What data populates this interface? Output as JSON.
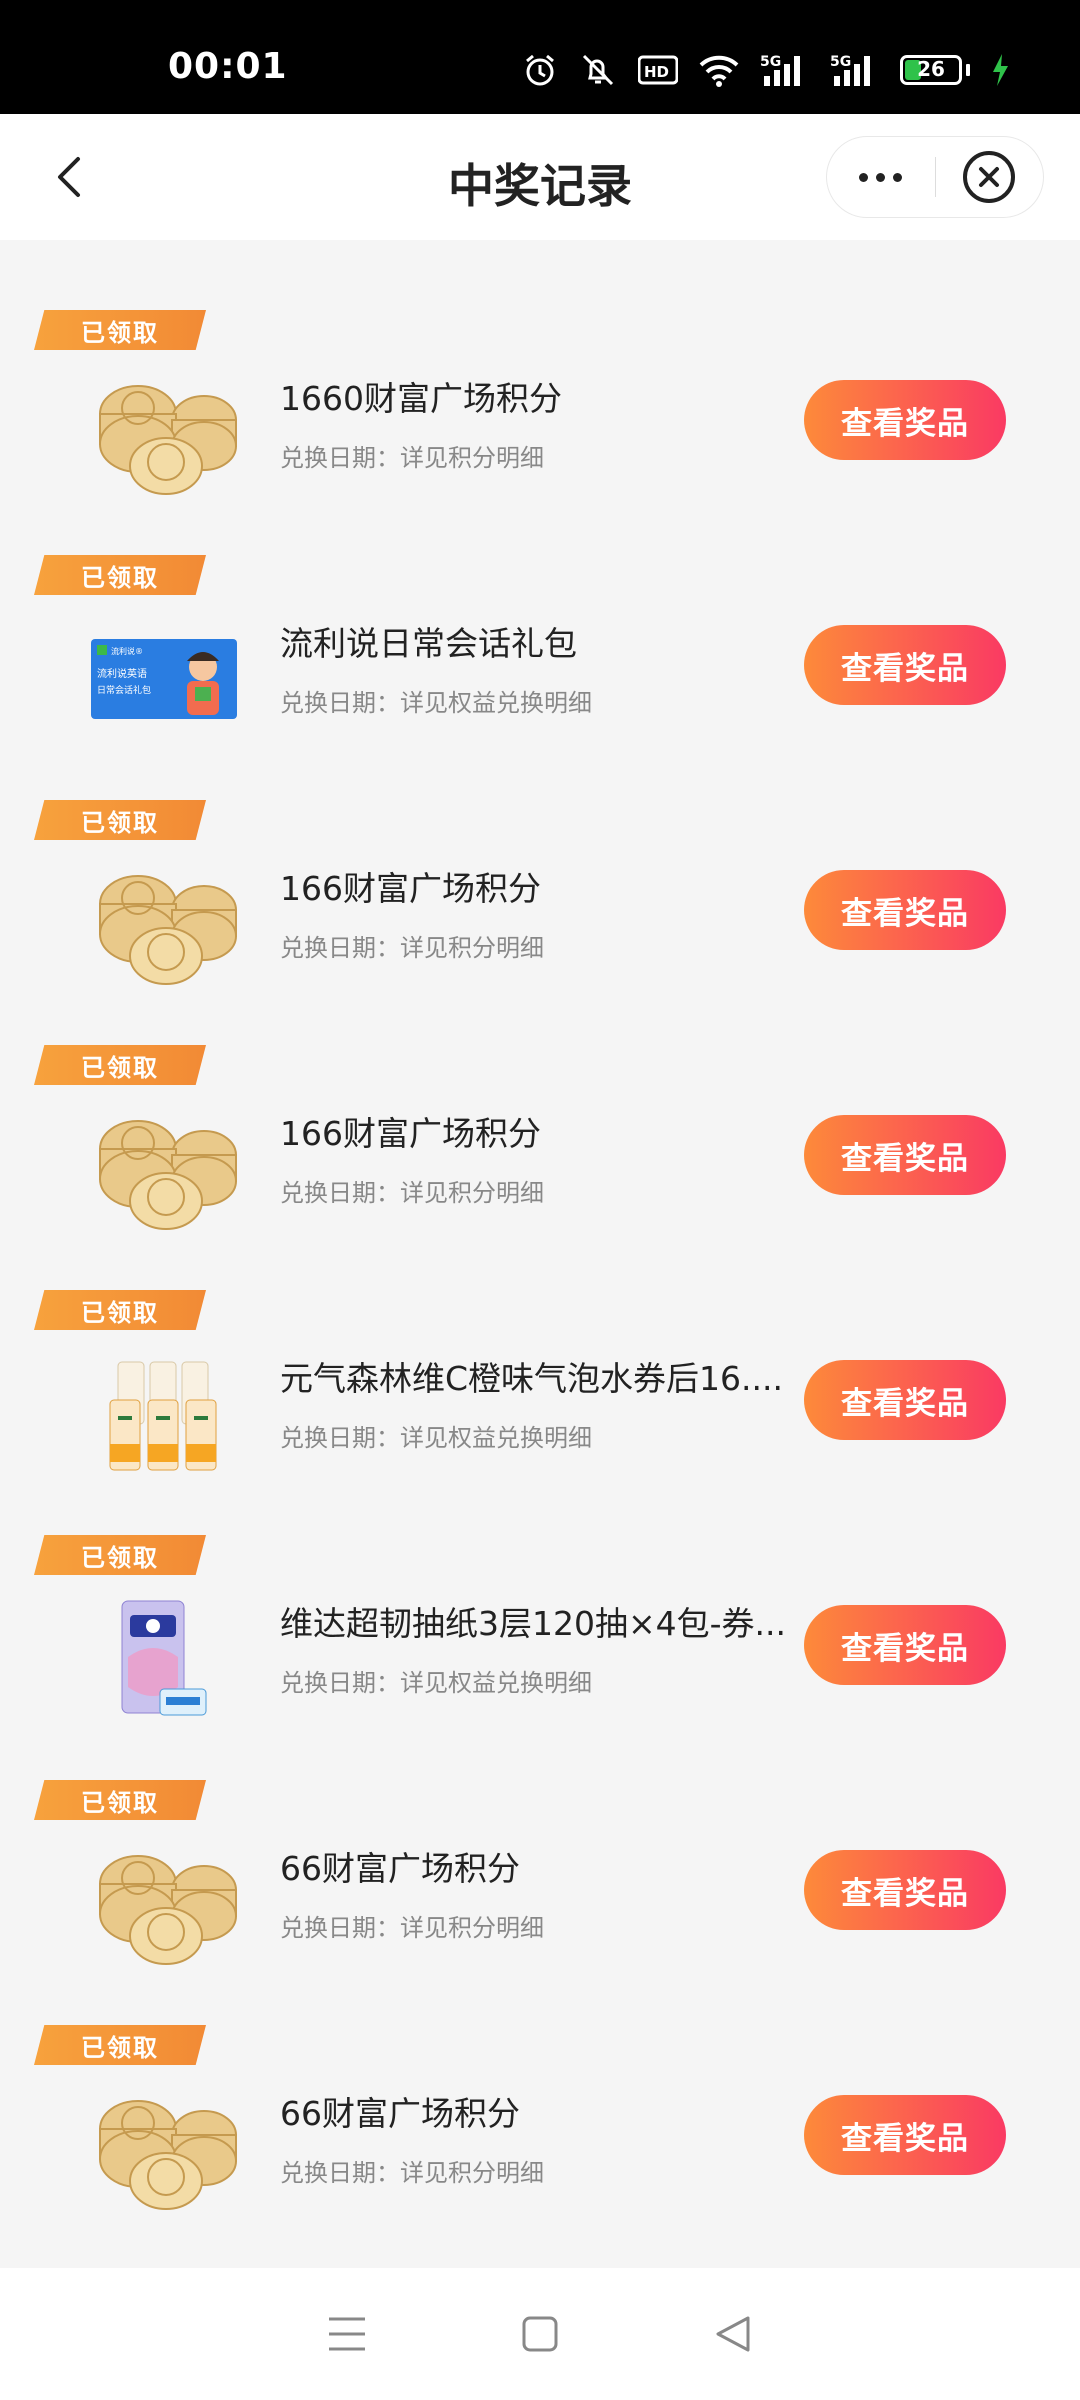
{
  "status_bar": {
    "time": "00:01",
    "battery": "26",
    "icons": [
      "alarm-icon",
      "mute-icon",
      "hd-icon",
      "wifi-icon",
      "5g-signal-icon",
      "5g-signal-icon",
      "battery-icon",
      "charging-icon"
    ]
  },
  "header": {
    "title": "中奖记录",
    "back_icon": "chevron-left-icon",
    "more_icon": "more-dots-icon",
    "close_icon": "close-circle-icon"
  },
  "records": [
    {
      "badge": "已领取",
      "title": "1660财富广场积分",
      "date": "兑换日期：详见积分明细",
      "button": "查看奖品",
      "thumb": "coin-stack"
    },
    {
      "badge": "已领取",
      "title": "流利说日常会话礼包",
      "date": "兑换日期：详见权益兑换明细",
      "button": "查看奖品",
      "thumb": "card",
      "thumb_text": {
        "brand": "流利说®",
        "line1": "流利说英语",
        "line2": "日常会话礼包"
      }
    },
    {
      "badge": "已领取",
      "title": "166财富广场积分",
      "date": "兑换日期：详见积分明细",
      "button": "查看奖品",
      "thumb": "coin-stack"
    },
    {
      "badge": "已领取",
      "title": "166财富广场积分",
      "date": "兑换日期：详见积分明细",
      "button": "查看奖品",
      "thumb": "coin-stack"
    },
    {
      "badge": "已领取",
      "title": "元气森林维C橙味气泡水券后16....",
      "date": "兑换日期：详见权益兑换明细",
      "button": "查看奖品",
      "thumb": "cans"
    },
    {
      "badge": "已领取",
      "title": "维达超韧抽纸3层120抽×4包-券...",
      "date": "兑换日期：详见权益兑换明细",
      "button": "查看奖品",
      "thumb": "tissue"
    },
    {
      "badge": "已领取",
      "title": "66财富广场积分",
      "date": "兑换日期：详见积分明细",
      "button": "查看奖品",
      "thumb": "coin-stack"
    },
    {
      "badge": "已领取",
      "title": "66财富广场积分",
      "date": "兑换日期：详见积分明细",
      "button": "查看奖品",
      "thumb": "coin-stack"
    }
  ],
  "nav": [
    "menu-icon",
    "home-square-icon",
    "back-triangle-icon"
  ]
}
